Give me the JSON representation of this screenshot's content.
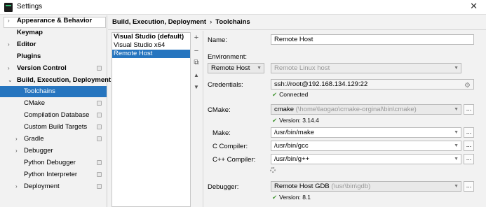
{
  "window": {
    "title": "Settings"
  },
  "sidebar": {
    "items": [
      {
        "label": "Appearance & Behavior",
        "expand": "›",
        "bold": true
      },
      {
        "label": "Keymap",
        "expand": "",
        "bold": true
      },
      {
        "label": "Editor",
        "expand": "›",
        "bold": true
      },
      {
        "label": "Plugins",
        "expand": "",
        "bold": true
      },
      {
        "label": "Version Control",
        "expand": "›",
        "bold": true,
        "badge": true
      },
      {
        "label": "Build, Execution, Deployment",
        "expand": "⌄",
        "bold": true
      },
      {
        "label": "Toolchains",
        "expand": "",
        "bold": false,
        "selected": true
      },
      {
        "label": "CMake",
        "expand": "",
        "bold": false,
        "badge": true
      },
      {
        "label": "Compilation Database",
        "expand": "",
        "bold": false,
        "badge": true
      },
      {
        "label": "Custom Build Targets",
        "expand": "",
        "bold": false,
        "badge": true
      },
      {
        "label": "Gradle",
        "expand": "›",
        "bold": false,
        "badge": true
      },
      {
        "label": "Debugger",
        "expand": "›",
        "bold": false
      },
      {
        "label": "Python Debugger",
        "expand": "",
        "bold": false,
        "badge": true
      },
      {
        "label": "Python Interpreter",
        "expand": "",
        "bold": false,
        "badge": true
      },
      {
        "label": "Deployment",
        "expand": "›",
        "bold": false,
        "badge": true
      }
    ]
  },
  "breadcrumb": {
    "parent": "Build, Execution, Deployment",
    "separator": "›",
    "current": "Toolchains"
  },
  "toolchains": {
    "items": [
      {
        "label": "Visual Studio (default)",
        "bold": true
      },
      {
        "label": "Visual Studio x64",
        "bold": false
      },
      {
        "label": "Remote Host",
        "bold": false,
        "selected": true
      }
    ],
    "tools": [
      "+",
      "−",
      "⧉",
      "▲",
      "▼"
    ]
  },
  "form": {
    "name_label": "Name:",
    "name_value": "Remote Host",
    "environment_label": "Environment:",
    "environment_value": "Remote Host",
    "environment_type": "Remote Linux host",
    "credentials_label": "Credentials:",
    "credentials_value": "ssh://root@192.168.134.129:22",
    "credentials_status": "Connected",
    "cmake_label": "CMake:",
    "cmake_value": "cmake",
    "cmake_path": "(\\home\\laogao\\cmake-orginal\\bin\\cmake)",
    "cmake_version": "Version: 3.14.4",
    "make_label": "Make:",
    "make_value": "/usr/bin/make",
    "c_compiler_label": "C Compiler:",
    "c_compiler_value": "/usr/bin/gcc",
    "cpp_compiler_label": "C++ Compiler:",
    "cpp_compiler_value": "/usr/bin/g++",
    "debugger_label": "Debugger:",
    "debugger_value": "Remote Host GDB",
    "debugger_path": "(\\usr\\bin\\gdb)",
    "debugger_version": "Version: 8.1",
    "browse_label": "..."
  },
  "colors": {
    "selection": "#2675bf",
    "ok": "#4a9a3a"
  }
}
